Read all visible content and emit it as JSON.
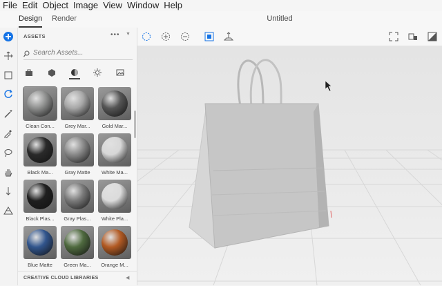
{
  "menu": [
    "File",
    "Edit",
    "Object",
    "Image",
    "View",
    "Window",
    "Help"
  ],
  "tabs": [
    "Design",
    "Render"
  ],
  "document_title": "Untitled",
  "assets": {
    "header": "ASSETS",
    "more": "•••",
    "search_placeholder": "Search Assets...",
    "categories": [
      "models-icon",
      "shapes-icon",
      "materials-icon",
      "lights-icon",
      "images-icon"
    ],
    "materials": [
      {
        "label": "Clean Con...",
        "color": "#8e8f8e"
      },
      {
        "label": "Grey Mar...",
        "color": "#a7a7a7"
      },
      {
        "label": "Gold Mar...",
        "color": "#555555"
      },
      {
        "label": "Black Ma...",
        "color": "#2a2a2a"
      },
      {
        "label": "Gray Matte",
        "color": "#8a8a8a"
      },
      {
        "label": "White Ma...",
        "color": "#d8d8d8"
      },
      {
        "label": "Black Plas...",
        "color": "#1f1f1f"
      },
      {
        "label": "Gray Plas...",
        "color": "#7a7a7a"
      },
      {
        "label": "White Pla...",
        "color": "#dcdcdc"
      },
      {
        "label": "Blue Matte",
        "color": "#31558d"
      },
      {
        "label": "Green Ma...",
        "color": "#4f6a3f"
      },
      {
        "label": "Orange M...",
        "color": "#b25a23"
      }
    ],
    "footer": "CREATIVE CLOUD LIBRARIES"
  },
  "colors": {
    "accent": "#1473e6",
    "active_tool": "#1473e6"
  }
}
